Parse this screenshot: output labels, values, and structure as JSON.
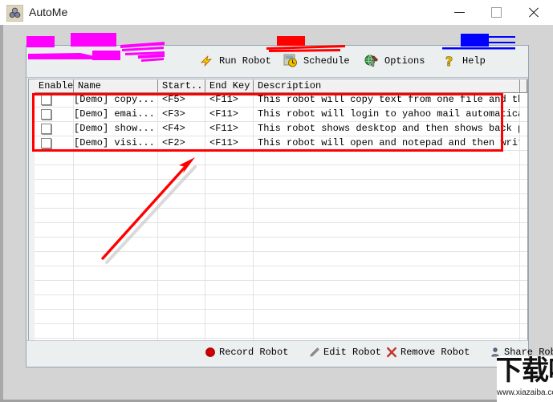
{
  "window": {
    "title": "AutoMe",
    "icon": "app-icon",
    "controls": {
      "minimize": "minimize-icon",
      "maximize": "maximize-icon",
      "close": "close-icon"
    }
  },
  "toolbar_top": {
    "items": [
      {
        "label": "Run Robot",
        "icon": "lightning-icon"
      },
      {
        "label": "Schedule",
        "icon": "clock-icon"
      },
      {
        "label": "Options",
        "icon": "globe-tools-icon"
      },
      {
        "label": "Help",
        "icon": "question-mark-icon"
      }
    ]
  },
  "list": {
    "columns": [
      {
        "label": "Enable"
      },
      {
        "label": "Name"
      },
      {
        "label": "Start..."
      },
      {
        "label": "End Key"
      },
      {
        "label": "Description"
      },
      {
        "label": ""
      }
    ],
    "rows": [
      {
        "enabled": false,
        "name": "[Demo] copy...",
        "start_key": "<F5>",
        "end_key": "<F11>",
        "description": "This robot will copy text from one file and then p..."
      },
      {
        "enabled": false,
        "name": "[Demo] emai...",
        "start_key": "<F3>",
        "end_key": "<F11>",
        "description": "This robot will login to yahoo mail automatically"
      },
      {
        "enabled": false,
        "name": "[Demo] show...",
        "start_key": "<F4>",
        "end_key": "<F11>",
        "description": "This robot shows desktop and then shows back progr..."
      },
      {
        "enabled": false,
        "name": "[Demo] visi...",
        "start_key": "<F2>",
        "end_key": "<F11>",
        "description": "This robot will open and notepad and then write"
      }
    ],
    "empty_row_count": 15
  },
  "toolbar_bottom": {
    "items": [
      {
        "label": "Record Robot",
        "icon": "record-circle-icon"
      },
      {
        "label": "Edit Robot",
        "icon": "pencil-icon"
      },
      {
        "label": "Remove Robot",
        "icon": "x-cross-icon"
      },
      {
        "label": "Share Robot",
        "icon": "share-person-icon"
      }
    ]
  },
  "annotations": {
    "highlight_box_color": "#ff0000",
    "arrow_color": "#ff0000",
    "scribble_magenta": "#ff00ff",
    "scribble_red": "#ff0000",
    "scribble_blue": "#0000ff"
  },
  "watermark": {
    "text_cn": "下载吧",
    "url": "www.xiazaiba.com"
  }
}
